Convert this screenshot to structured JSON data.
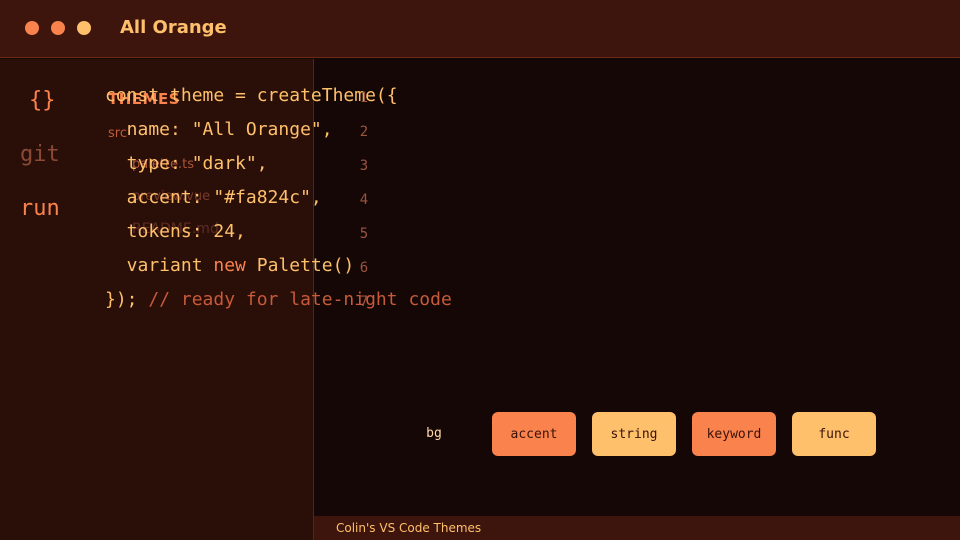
{
  "window": {
    "title": "All Orange",
    "controls": [
      "close",
      "minimize",
      "maximize"
    ]
  },
  "activity_bar": {
    "items": [
      {
        "label": "{}",
        "icon": "braces-icon"
      },
      {
        "label": "git"
      },
      {
        "label": "run"
      }
    ]
  },
  "explorer": {
    "header": "THEMES",
    "folder": "src",
    "files": [
      "palette.ts",
      "preview.vue",
      "README.md"
    ]
  },
  "editor": {
    "lines": [
      {
        "a": "const",
        "b": " theme = createTheme({"
      },
      {
        "a": "  name: \"All Orange\","
      },
      {
        "a": "  type: \"dark\","
      },
      {
        "a": "  accent: \"#fa824c\","
      },
      {
        "a": "  tokens: 24,"
      },
      {
        "a": "  variant ",
        "kw": "new",
        "b": " Palette()"
      },
      {
        "a": "});",
        "comment": " // ready for late-night code"
      }
    ],
    "line_numbers": [
      "1",
      "2",
      "3",
      "4",
      "5",
      "6",
      "7"
    ]
  },
  "palette": {
    "bg_label": "bg",
    "swatches": [
      "accent",
      "string",
      "keyword",
      "func"
    ]
  },
  "statusbar": {
    "text": "Colin's VS Code Themes"
  },
  "colors": {
    "accent": "#fa824c",
    "string": "#ffc06b",
    "background": "#140705",
    "sidebar": "#2a0e08",
    "titlebar": "#3d150c"
  }
}
